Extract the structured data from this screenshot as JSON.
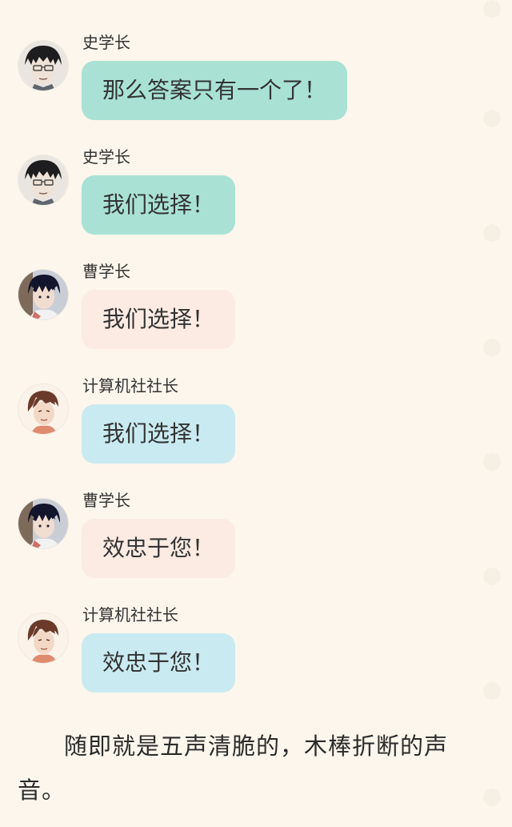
{
  "theme": {
    "background": "#fdf6ec",
    "bubble_teal": "#a9e2d5",
    "bubble_peach": "#fcebe2",
    "bubble_blue": "#c9eaf0"
  },
  "messages": [
    {
      "sender": "史学长",
      "text": "那么答案只有一个了！",
      "avatar_icon": "glasses-man-avatar-icon",
      "bubble_color": "teal"
    },
    {
      "sender": "史学长",
      "text": "我们选择！",
      "avatar_icon": "glasses-man-avatar-icon",
      "bubble_color": "teal"
    },
    {
      "sender": "曹学长",
      "text": "我们选择！",
      "avatar_icon": "dark-hair-man-avatar-icon",
      "bubble_color": "peach"
    },
    {
      "sender": "计算机社社长",
      "text": "我们选择！",
      "avatar_icon": "brown-hair-man-avatar-icon",
      "bubble_color": "blue"
    },
    {
      "sender": "曹学长",
      "text": "效忠于您！",
      "avatar_icon": "dark-hair-man-avatar-icon",
      "bubble_color": "peach"
    },
    {
      "sender": "计算机社社长",
      "text": "效忠于您！",
      "avatar_icon": "brown-hair-man-avatar-icon",
      "bubble_color": "blue"
    }
  ],
  "narration": "随即就是五声清脆的，木棒折断的声音。"
}
